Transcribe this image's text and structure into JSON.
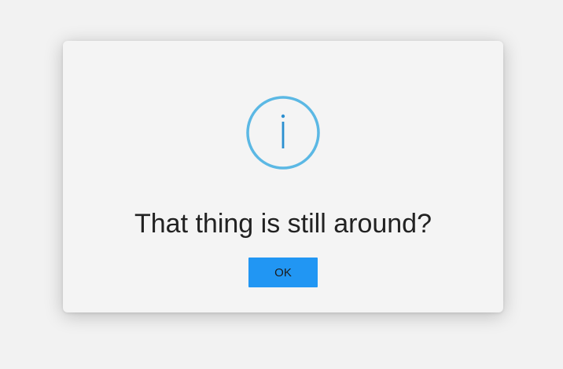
{
  "dialog": {
    "icon": "info-icon",
    "message": "That thing is still around?",
    "ok_label": "OK"
  },
  "colors": {
    "icon_ring": "#5bb8e4",
    "icon_glyph": "#2a8fd0",
    "button_bg": "#2196f3",
    "dialog_bg": "#f4f4f4",
    "text": "#222222"
  }
}
